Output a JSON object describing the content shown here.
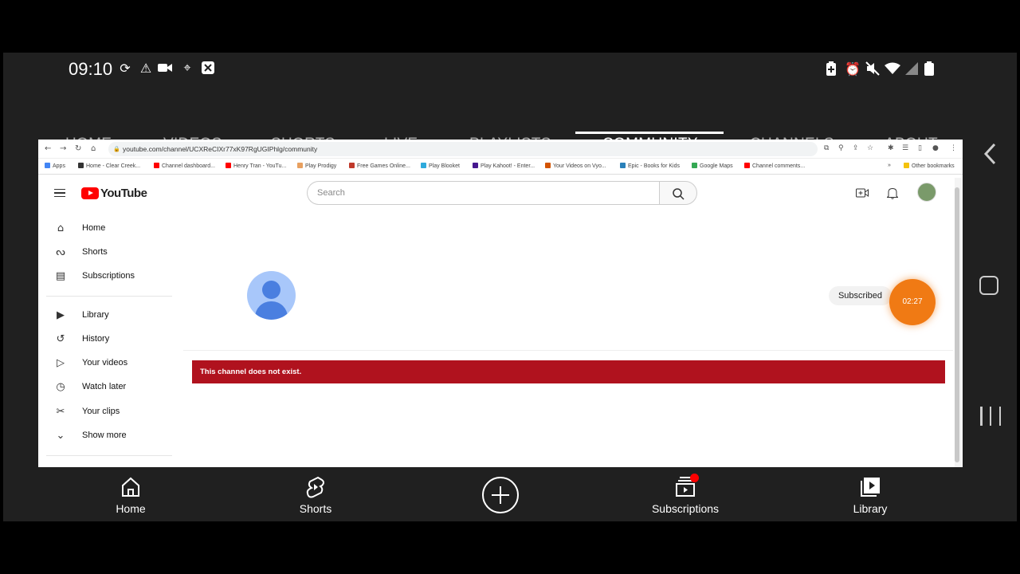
{
  "status_bar": {
    "time": "09:10",
    "left_icons": [
      "sync-icon",
      "warning-icon",
      "video-camera-icon",
      "location-icon",
      "close-box-icon"
    ],
    "right_icons": [
      "battery-saver-icon",
      "alarm-icon",
      "mute-icon",
      "wifi-icon",
      "signal-icon",
      "battery-icon"
    ]
  },
  "channel_tabs": [
    {
      "label": "HOME",
      "active": false
    },
    {
      "label": "VIDEOS",
      "active": false
    },
    {
      "label": "SHORTS",
      "active": false
    },
    {
      "label": "LIVE",
      "active": false
    },
    {
      "label": "PLAYLISTS",
      "active": false
    },
    {
      "label": "COMMUNITY",
      "active": true
    },
    {
      "label": "CHANNELS",
      "active": false
    },
    {
      "label": "ABOUT",
      "active": false
    }
  ],
  "browser": {
    "url": "youtube.com/channel/UCXReCIXr77xK97RgUGIPhlg/community",
    "bookmarks": [
      {
        "label": "Apps",
        "color": "#4285f4"
      },
      {
        "label": "Home - Clear Creek...",
        "color": "#333333"
      },
      {
        "label": "Channel dashboard...",
        "color": "#ff0000"
      },
      {
        "label": "Henry Tran - YouTu...",
        "color": "#ff0000"
      },
      {
        "label": "Play Prodigy",
        "color": "#e8a060"
      },
      {
        "label": "Free Games Online...",
        "color": "#c0392b"
      },
      {
        "label": "Play Blooket",
        "color": "#2eaadc"
      },
      {
        "label": "Play Kahoot! - Enter...",
        "color": "#46178f"
      },
      {
        "label": "Your Videos on Vyo...",
        "color": "#d35400"
      },
      {
        "label": "Epic - Books for Kids",
        "color": "#2980b9"
      },
      {
        "label": "Google Maps",
        "color": "#34a853"
      },
      {
        "label": "Channel comments...",
        "color": "#ff0000"
      },
      {
        "label": "Other bookmarks",
        "color": "#f4c20d"
      }
    ],
    "youtube": {
      "logo_text": "YouTube",
      "search_placeholder": "Search",
      "sidebar": [
        {
          "label": "Home",
          "icon": "home-icon"
        },
        {
          "label": "Shorts",
          "icon": "shorts-icon"
        },
        {
          "label": "Subscriptions",
          "icon": "subscriptions-icon"
        },
        {
          "label": "Library",
          "icon": "library-icon"
        },
        {
          "label": "History",
          "icon": "history-icon"
        },
        {
          "label": "Your videos",
          "icon": "your-videos-icon"
        },
        {
          "label": "Watch later",
          "icon": "clock-icon"
        },
        {
          "label": "Your clips",
          "icon": "scissors-icon"
        },
        {
          "label": "Show more",
          "icon": "chevron-down-icon"
        }
      ],
      "subscribed_label": "Subscribed",
      "error_message": "This channel does not exist."
    }
  },
  "timer": "02:27",
  "bottom_nav": [
    {
      "label": "Home",
      "icon": "home-icon"
    },
    {
      "label": "Shorts",
      "icon": "shorts-icon"
    },
    {
      "label": "",
      "icon": "create-icon"
    },
    {
      "label": "Subscriptions",
      "icon": "subscriptions-icon"
    },
    {
      "label": "Library",
      "icon": "library-icon"
    }
  ]
}
